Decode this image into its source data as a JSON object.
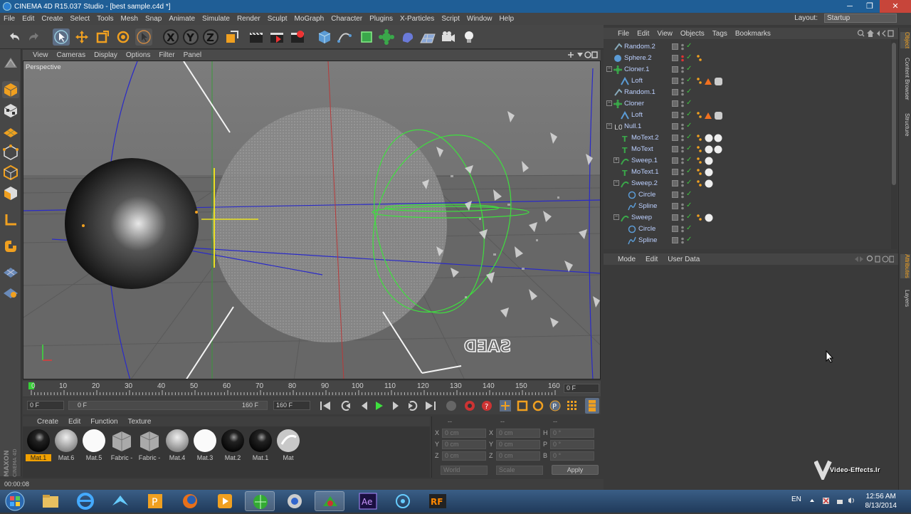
{
  "window": {
    "title": "CINEMA 4D R15.037 Studio - [best sample.c4d *]"
  },
  "menu": [
    "File",
    "Edit",
    "Create",
    "Select",
    "Tools",
    "Mesh",
    "Snap",
    "Animate",
    "Simulate",
    "Render",
    "Sculpt",
    "MoGraph",
    "Character",
    "Plugins",
    "X-Particles",
    "Script",
    "Window",
    "Help"
  ],
  "layout": {
    "label": "Layout:",
    "value": "Startup"
  },
  "viewport": {
    "menu": [
      "View",
      "Cameras",
      "Display",
      "Options",
      "Filter",
      "Panel"
    ],
    "label": "Perspective",
    "mirrored_text": "SAED"
  },
  "timeline": {
    "ticks": [
      "0",
      "10",
      "20",
      "30",
      "40",
      "50",
      "60",
      "70",
      "80",
      "90",
      "100",
      "110",
      "120",
      "130",
      "140",
      "150",
      "160"
    ],
    "current_frame": "0 F",
    "start_frame": "0 F",
    "range_start": "0 F",
    "range_end": "160 F",
    "end_frame": "160 F"
  },
  "materials": {
    "menu": [
      "Create",
      "Edit",
      "Function",
      "Texture"
    ],
    "items": [
      {
        "label": "Mat.1",
        "kind": "black",
        "selected": true
      },
      {
        "label": "Mat.6",
        "kind": "gray"
      },
      {
        "label": "Mat.5",
        "kind": "white"
      },
      {
        "label": "Fabric -",
        "kind": "fabric"
      },
      {
        "label": "Fabric -",
        "kind": "fabric"
      },
      {
        "label": "Mat.4",
        "kind": "gray"
      },
      {
        "label": "Mat.3",
        "kind": "white"
      },
      {
        "label": "Mat.2",
        "kind": "black"
      },
      {
        "label": "Mat.1",
        "kind": "black"
      },
      {
        "label": "Mat",
        "kind": "glass"
      }
    ]
  },
  "coords": {
    "headers": [
      "--",
      "--",
      "--"
    ],
    "rows": [
      {
        "a": "X",
        "av": "0 cm",
        "b": "X",
        "bv": "0 cm",
        "c": "H",
        "cv": "0 °"
      },
      {
        "a": "Y",
        "av": "0 cm",
        "b": "Y",
        "bv": "0 cm",
        "c": "P",
        "cv": "0 °"
      },
      {
        "a": "Z",
        "av": "0 cm",
        "b": "Z",
        "bv": "0 cm",
        "c": "B",
        "cv": "0 °"
      }
    ],
    "world": "World",
    "scale": "Scale",
    "apply": "Apply"
  },
  "status": {
    "text": "00:00:08"
  },
  "objects": {
    "menu": [
      "File",
      "Edit",
      "View",
      "Objects",
      "Tags",
      "Bookmarks"
    ],
    "rows": [
      {
        "name": "Random.2",
        "indent": 0
      },
      {
        "name": "Sphere.2",
        "indent": 0
      },
      {
        "name": "Cloner.1",
        "indent": 0
      },
      {
        "name": "Loft",
        "indent": 1
      },
      {
        "name": "Random.1",
        "indent": 0
      },
      {
        "name": "Cloner",
        "indent": 0
      },
      {
        "name": "Loft",
        "indent": 1
      },
      {
        "name": "Null.1",
        "indent": 0
      },
      {
        "name": "MoText.2",
        "indent": 1
      },
      {
        "name": "MoText",
        "indent": 1
      },
      {
        "name": "Sweep.1",
        "indent": 1
      },
      {
        "name": "MoText.1",
        "indent": 1
      },
      {
        "name": "Sweep.2",
        "indent": 1
      },
      {
        "name": "Circle",
        "indent": 2
      },
      {
        "name": "Spline",
        "indent": 2
      },
      {
        "name": "Sweep",
        "indent": 1
      },
      {
        "name": "Circle",
        "indent": 2
      },
      {
        "name": "Spline",
        "indent": 2
      }
    ]
  },
  "attributes": {
    "menu": [
      "Mode",
      "Edit",
      "User Data"
    ]
  },
  "side_tabs": [
    "Object",
    "Content Browser",
    "Structure",
    "Attributes",
    "Layers"
  ],
  "brand": {
    "logo_top": "MAXON",
    "logo_bottom": "CINEMA 4D",
    "watermark": "Video-Effects.Ir"
  },
  "taskbar": {
    "lang": "EN",
    "time": "12:56 AM",
    "date": "8/13/2014"
  }
}
